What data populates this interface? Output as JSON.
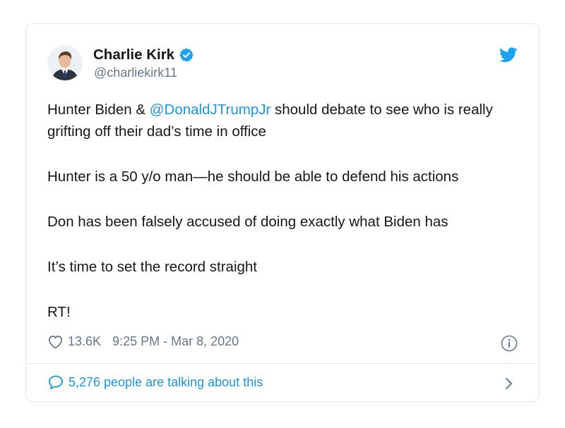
{
  "tweet": {
    "author_name": "Charlie Kirk",
    "author_handle": "@charliekirk11",
    "verified": true,
    "text_line1_prefix": "Hunter Biden & ",
    "text_line1_mention": "@DonaldJTrumpJr",
    "text_line1_suffix": " should debate to see who is really grifting off their dad’s time in office",
    "paragraph2": "Hunter is a 50 y/o man—he should be able to defend his actions",
    "paragraph3": "Don has been falsely accused of doing exactly what Biden has",
    "paragraph4": "It’s time to set the record straight",
    "paragraph5": "RT!",
    "likes": "13.6K",
    "timestamp": "9:25 PM - Mar 8, 2020",
    "talking": "5,276 people are talking about this"
  },
  "icons": {
    "verified": "verified-badge-icon",
    "bird": "twitter-bird-icon",
    "heart": "heart-icon",
    "info": "info-icon",
    "comment": "speech-bubble-icon",
    "chevron": "chevron-right-icon"
  },
  "colors": {
    "link": "#1b95e0",
    "text": "#14171a",
    "muted": "#657786",
    "border": "#e1e8ed"
  }
}
